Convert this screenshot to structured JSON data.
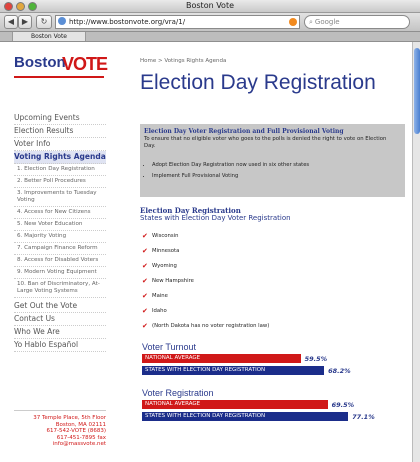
{
  "browser": {
    "window_title": "Boston Vote",
    "url": "http://www.bostonvote.org/vra/1/",
    "search_placeholder": "Google",
    "tab_title": "Boston Vote"
  },
  "logo": {
    "part1": "Boston",
    "part2": "VOTE"
  },
  "sidebar": {
    "top_items": [
      "Upcoming Events",
      "Election Results",
      "Voter Info"
    ],
    "active_item": "Voting Rights Agenda",
    "sub_items": [
      "1. Election Day Registration",
      "2. Better Poll Procedures",
      "3. Improvements to Tuesday Voting",
      "4. Access for New Citizens",
      "5. New Voter Education",
      "6. Majority Voting",
      "7. Campaign Finance Reform",
      "8. Access for Disabled Voters",
      "9. Modern Voting Equipment",
      "10. Ban of Discriminatory, At-Large Voting Systems"
    ],
    "bottom_items": [
      "Get Out the Vote",
      "Contact Us",
      "Who We Are",
      "Yo Hablo Español"
    ],
    "address": [
      "37 Temple Place, 5th Floor",
      "Boston, MA 02111",
      "617-542-VOTE (8683)",
      "617-451-7895 fax",
      "info@massvote.net"
    ]
  },
  "main": {
    "breadcrumb": "Home > Votings Rights Agenda",
    "title": "Election Day Registration",
    "box": {
      "heading": "Election Day Voter Registration and Full Provisional Voting",
      "text": "To ensure that no eligible voter who goes to the polls is denied the right to vote on Election Day.",
      "bullets": [
        "Adopt Election Day Registration now used in six other states",
        "Implement Full Provisional Voting"
      ]
    },
    "section_heading": "Election Day Registration",
    "section_subheading": "States with Election Day Voter Registration",
    "states": [
      "Wisconsin",
      "Minnesota",
      "Wyoming",
      "New Hampshire",
      "Maine",
      "Idaho",
      "(North Dakota has no voter registration law)"
    ],
    "turnout": {
      "title": "Voter Turnout",
      "rows": [
        {
          "label": "NATIONAL AVERAGE",
          "value": 59.5,
          "display": "59.5%",
          "color": "#d01818"
        },
        {
          "label": "STATES WITH ELECTION DAY REGISTRATION",
          "value": 68.2,
          "display": "68.2%",
          "color": "#1b2d8a"
        }
      ]
    },
    "registration": {
      "title": "Voter Registration",
      "rows": [
        {
          "label": "NATIONAL AVERAGE",
          "value": 69.5,
          "display": "69.5%",
          "color": "#d01818"
        },
        {
          "label": "STATES WITH ELECTION DAY REGISTRATION",
          "value": 77.1,
          "display": "77.1%",
          "color": "#1b2d8a"
        }
      ]
    }
  }
}
